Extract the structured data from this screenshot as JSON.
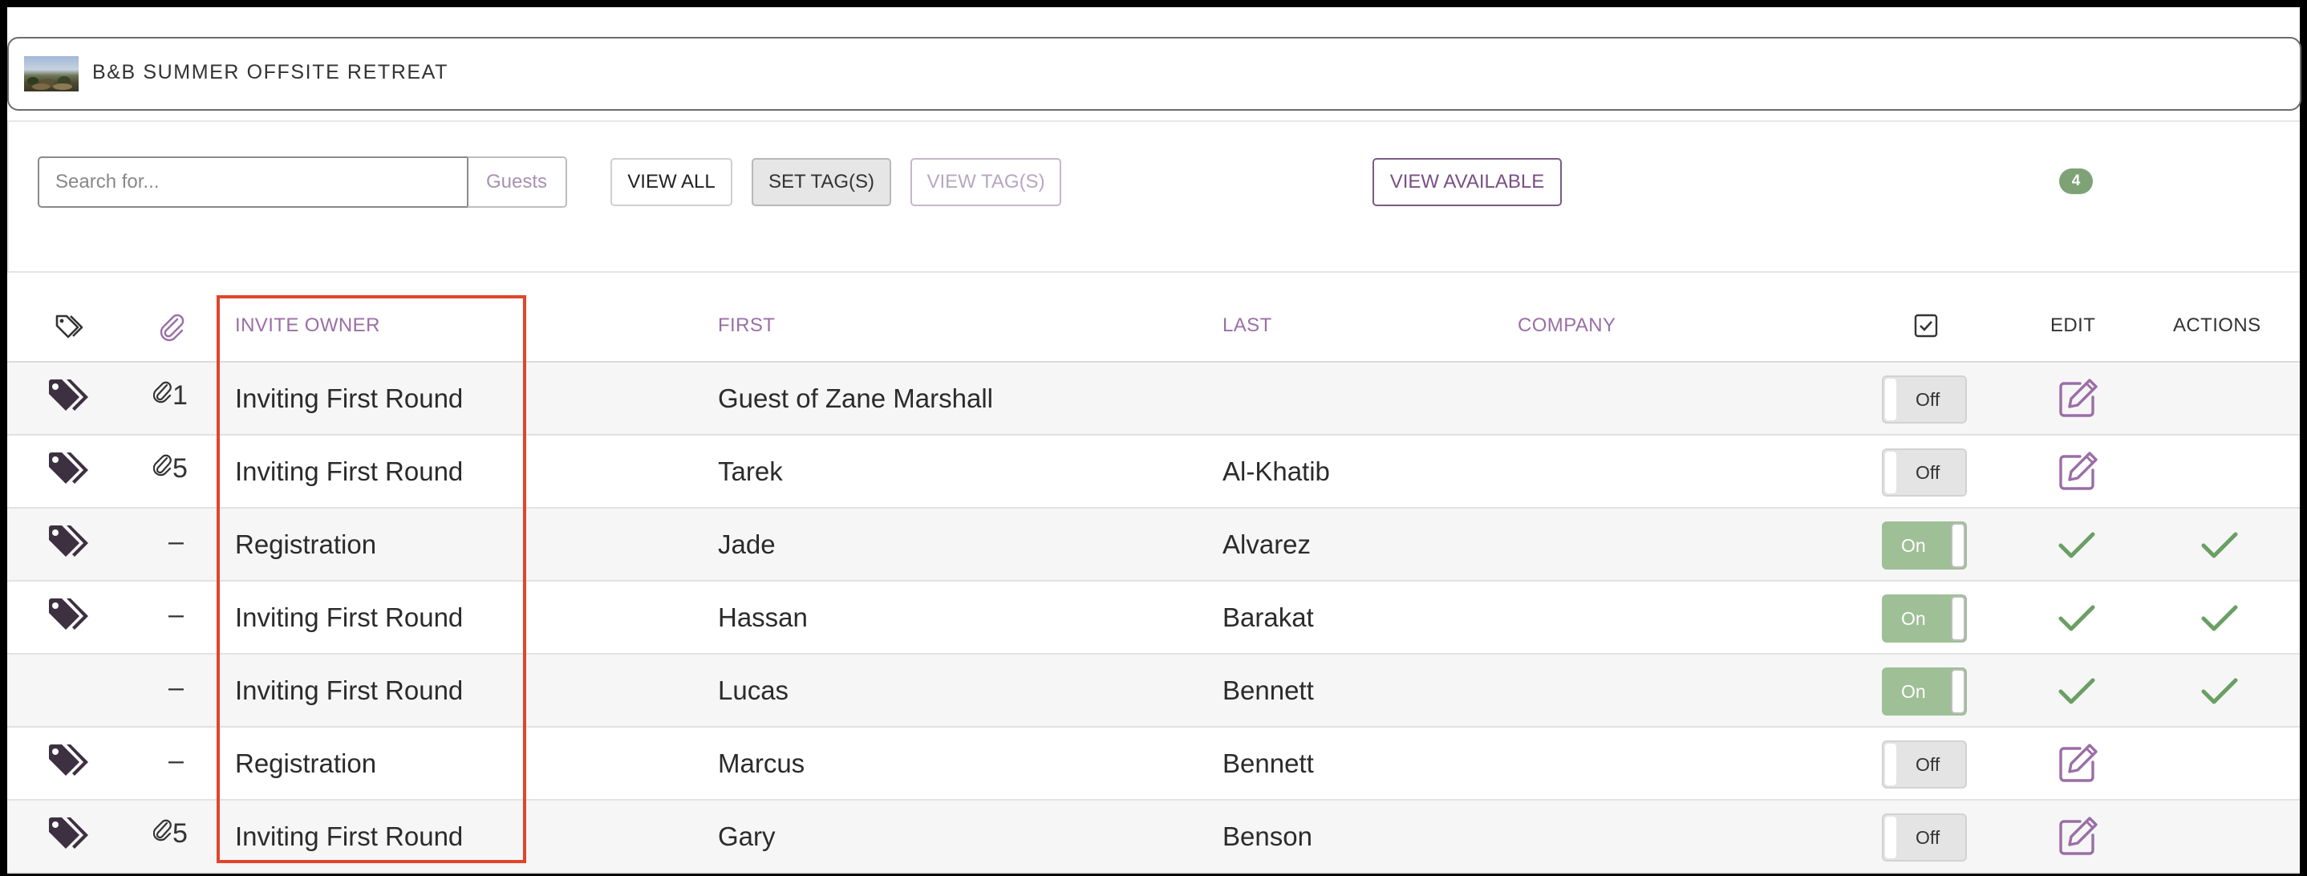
{
  "event": {
    "title": "B&B SUMMER OFFSITE RETREAT",
    "thumbnail_icon": "landscape-thumbnail"
  },
  "toolbar": {
    "search_placeholder": "Search for...",
    "search_value": "",
    "guests_label": "Guests",
    "view_all_label": "VIEW ALL",
    "set_tags_label": "SET TAG(S)",
    "view_tags_label": "VIEW TAG(S)",
    "view_available_label": "VIEW AVAILABLE",
    "count_badge": "4"
  },
  "table": {
    "columns": {
      "tags_icon": "tag-outline-icon",
      "attachments_icon": "paperclip-icon",
      "invite_owner": "INVITE OWNER",
      "first": "FIRST",
      "last": "LAST",
      "company": "COMPANY",
      "checkbox_icon": "checkbox-checked-icon",
      "edit": "EDIT",
      "actions": "ACTIONS"
    },
    "rows": [
      {
        "has_tags": true,
        "attachments": "1",
        "invite_owner": "Inviting First Round",
        "first": "Guest of Zane Marshall",
        "last": "",
        "company": "",
        "toggle": "Off",
        "status": "editable"
      },
      {
        "has_tags": true,
        "attachments": "5",
        "invite_owner": "Inviting First Round",
        "first": "Tarek",
        "last": "Al-Khatib",
        "company": "",
        "toggle": "Off",
        "status": "editable"
      },
      {
        "has_tags": true,
        "attachments": "–",
        "invite_owner": "Registration",
        "first": "Jade",
        "last": "Alvarez",
        "company": "",
        "toggle": "On",
        "status": "confirmed"
      },
      {
        "has_tags": true,
        "attachments": "–",
        "invite_owner": "Inviting First Round",
        "first": "Hassan",
        "last": "Barakat",
        "company": "",
        "toggle": "On",
        "status": "confirmed"
      },
      {
        "has_tags": false,
        "attachments": "–",
        "invite_owner": "Inviting First Round",
        "first": "Lucas",
        "last": "Bennett",
        "company": "",
        "toggle": "On",
        "status": "confirmed"
      },
      {
        "has_tags": true,
        "attachments": "–",
        "invite_owner": "Registration",
        "first": "Marcus",
        "last": "Bennett",
        "company": "",
        "toggle": "Off",
        "status": "editable"
      },
      {
        "has_tags": true,
        "attachments": "5",
        "invite_owner": "Inviting First Round",
        "first": "Gary",
        "last": "Benson",
        "company": "",
        "toggle": "Off",
        "status": "editable"
      }
    ]
  },
  "colors": {
    "accent_purple": "#9a6ea6",
    "toggle_on_green": "#9fbf97",
    "check_green": "#6a9f64",
    "highlight_red": "#e0452c"
  }
}
